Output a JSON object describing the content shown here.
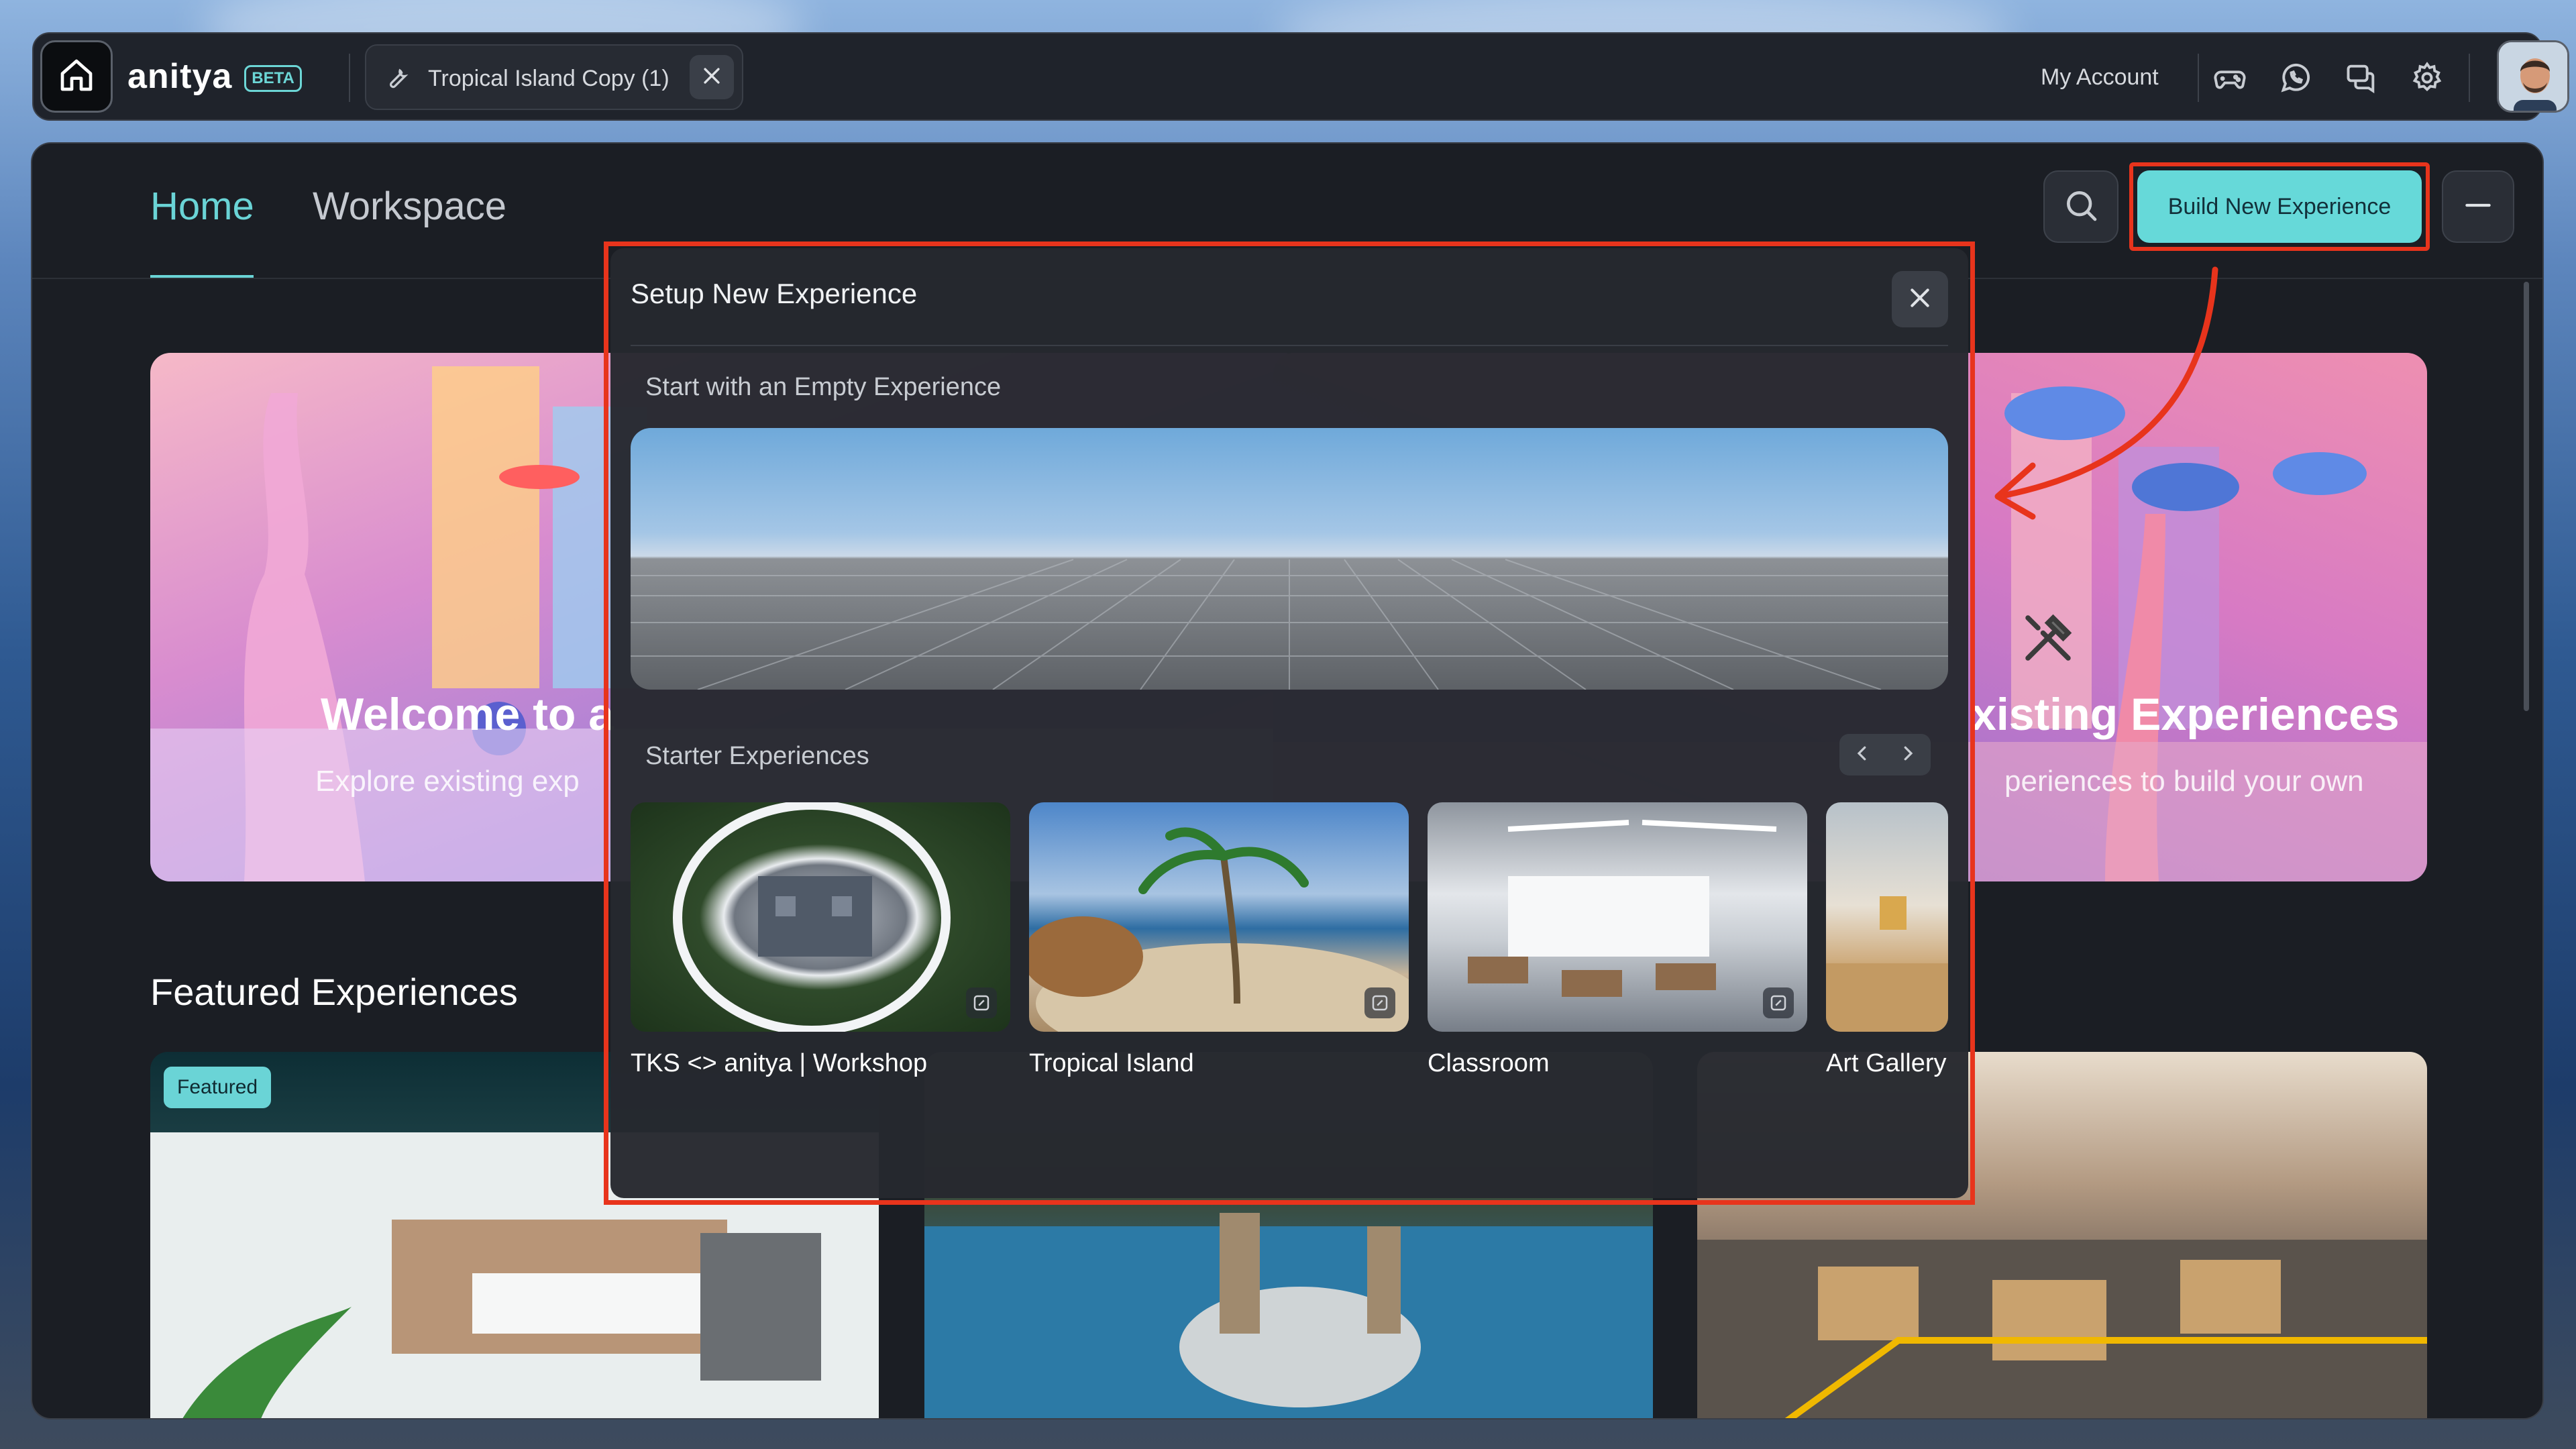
{
  "topbar": {
    "brand": "anitya",
    "beta_badge": "BETA",
    "open_tab_label": "Tropical Island Copy (1)",
    "my_account": "My Account",
    "icons": [
      "home-icon",
      "wrench-icon",
      "close-icon",
      "gamepad-icon",
      "whatsapp-icon",
      "chat-icon",
      "settings-icon"
    ]
  },
  "nav": {
    "home": "Home",
    "workspace": "Workspace",
    "build_button": "Build New Experience"
  },
  "hero": {
    "left_title": "Welcome to a",
    "left_subtitle": "Explore existing exp",
    "right_title": "xisting Experiences",
    "right_subtitle": "periences to build your own"
  },
  "featured": {
    "heading": "Featured Experiences",
    "badge": "Featured"
  },
  "modal": {
    "title": "Setup New Experience",
    "empty_section": "Start with an Empty Experience",
    "starter_section": "Starter Experiences",
    "starters": [
      {
        "name": "TKS <> anitya | Workshop"
      },
      {
        "name": "Tropical Island"
      },
      {
        "name": "Classroom"
      },
      {
        "name": "Art Gallery"
      }
    ]
  },
  "colors": {
    "accent": "#66d9d9",
    "highlight_outline": "#e8341c",
    "panel_bg": "#1b1e24"
  }
}
